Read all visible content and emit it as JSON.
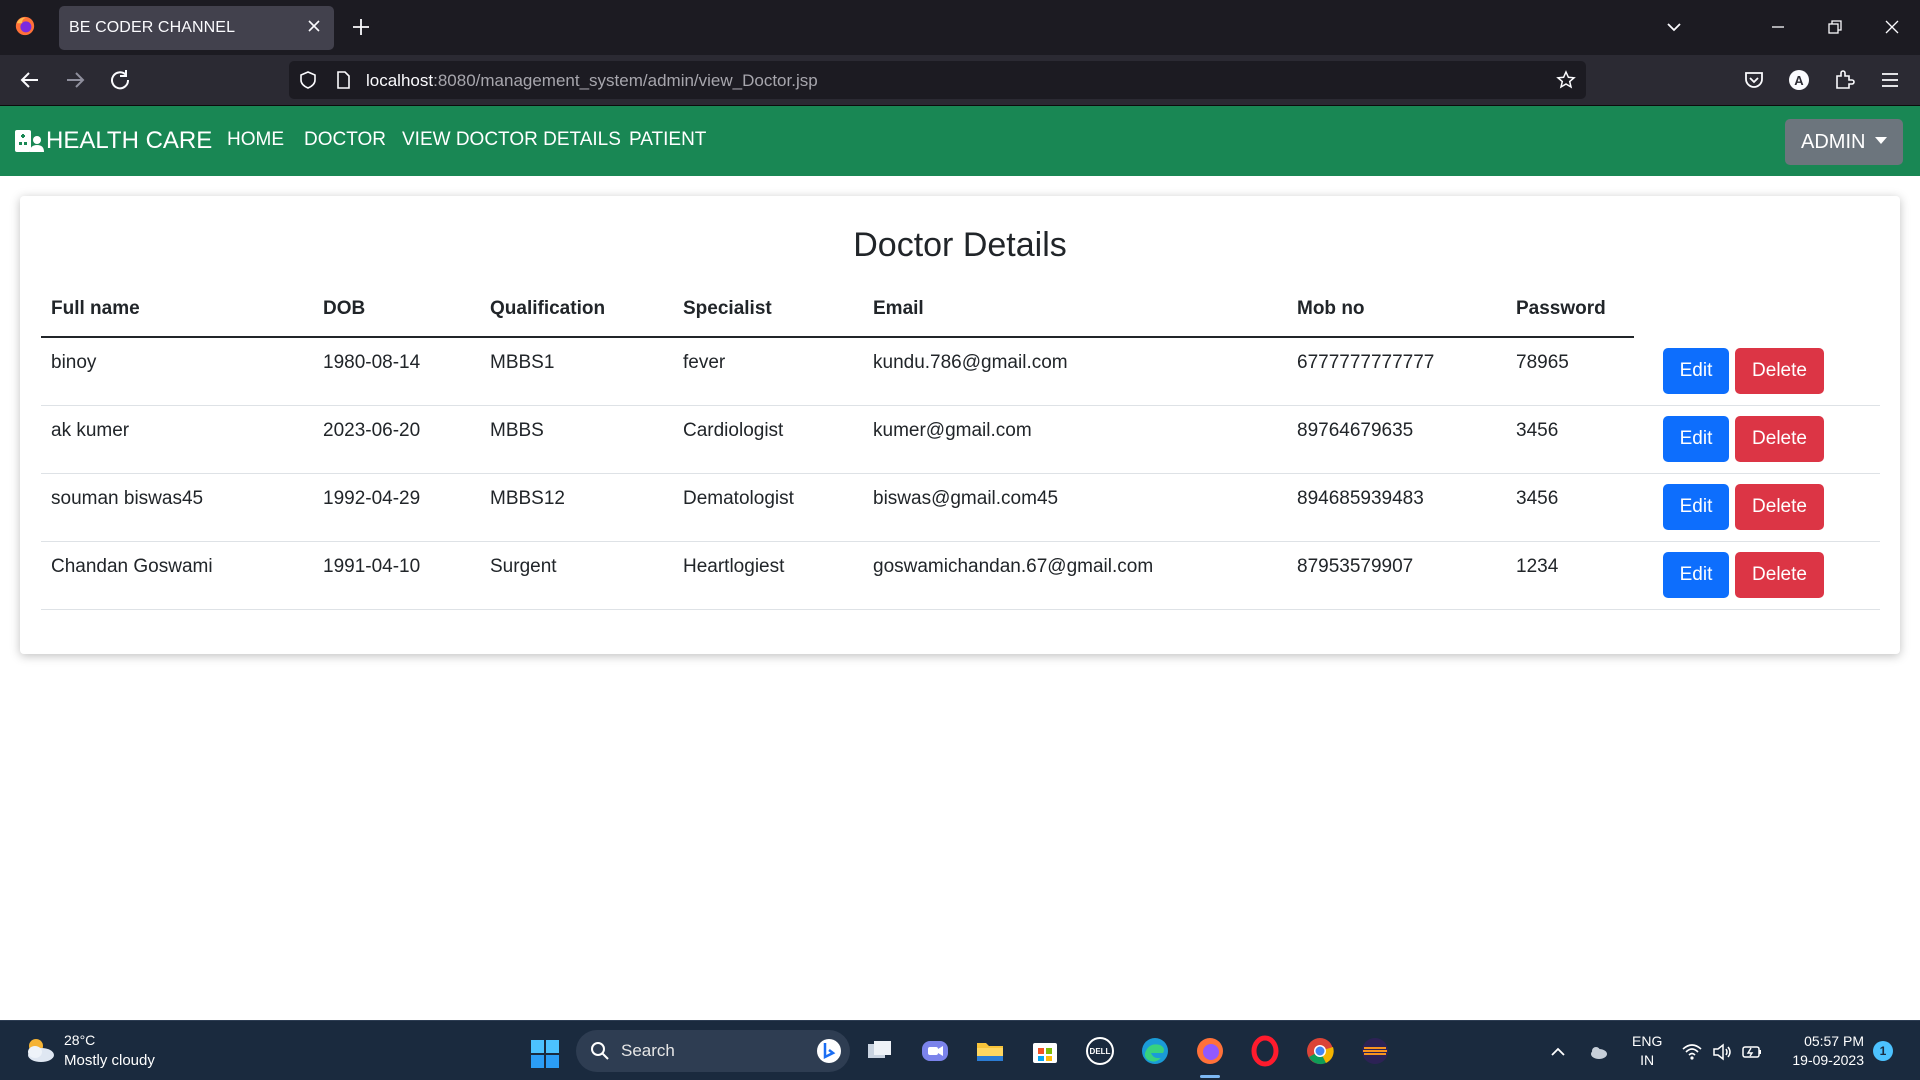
{
  "browser": {
    "tab_title": "BE CODER CHANNEL",
    "url_host": "localhost",
    "url_rest": ":8080/management_system/admin/view_Doctor.jsp"
  },
  "app": {
    "brand": "HEALTH CARE",
    "nav": [
      "HOME",
      "DOCTOR",
      "VIEW DOCTOR DETAILS",
      "PATIENT"
    ],
    "admin_label": "ADMIN"
  },
  "card": {
    "title": "Doctor Details",
    "headers": [
      "Full name",
      "DOB",
      "Qualification",
      "Specialist",
      "Email",
      "Mob no",
      "Password"
    ],
    "edit_label": "Edit",
    "delete_label": "Delete",
    "rows": [
      [
        "binoy",
        "1980-08-14",
        "MBBS1",
        "fever",
        "kundu.786@gmail.com",
        "6777777777777",
        "78965"
      ],
      [
        "ak kumer",
        "2023-06-20",
        "MBBS",
        "Cardiologist",
        "kumer@gmail.com",
        "89764679635",
        "3456"
      ],
      [
        "souman biswas45",
        "1992-04-29",
        "MBBS12",
        "Dematologist",
        "biswas@gmail.com45",
        "894685939483",
        "3456"
      ],
      [
        "Chandan Goswami",
        "1991-04-10",
        "Surgent",
        "Heartlogiest",
        "goswamichandan.67@gmail.com",
        "87953579907",
        "1234"
      ]
    ]
  },
  "taskbar": {
    "weather_temp": "28°C",
    "weather_desc": "Mostly cloudy",
    "search_placeholder": "Search",
    "lang_line1": "ENG",
    "lang_line2": "IN",
    "time": "05:57 PM",
    "date": "19-09-2023",
    "notification_count": "1"
  },
  "colors": {
    "app_nav": "#198754",
    "edit_button": "#0d6efd",
    "delete_button": "#dc3545",
    "admin_button": "#6c757d"
  }
}
